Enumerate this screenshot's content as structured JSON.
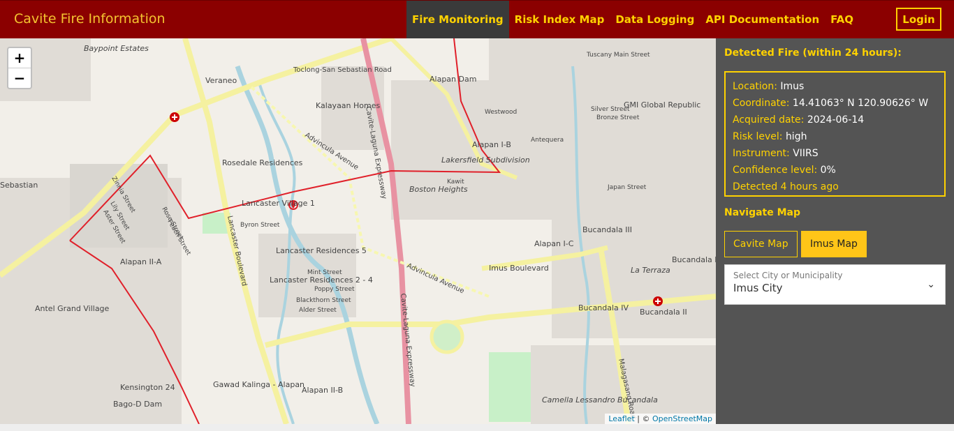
{
  "navbar": {
    "brand": "Cavite Fire Information",
    "links": [
      {
        "label": "Fire Monitoring"
      },
      {
        "label": "Risk Index Map"
      },
      {
        "label": "Data Logging"
      },
      {
        "label": "API Documentation"
      },
      {
        "label": "FAQ"
      }
    ],
    "login_label": "Login"
  },
  "map": {
    "zoom_in": "+",
    "zoom_out": "−",
    "labels": {
      "veraneo": "Veraneo",
      "kalayaan_homes": "Kalayaan Homes",
      "rosedale": "Rosedale Residences",
      "lancaster1": "Lancaster Village 1",
      "lancaster5": "Lancaster Residences 5",
      "lancaster24": "Lancaster Residences 2 - 4",
      "advincula": "Advincula Avenue",
      "cavite_laguna": "Cavite-Laguna Expressway",
      "lancaster_blvd": "Lancaster Boulevard",
      "alapan_dam": "Alapan Dam",
      "alapan_ib": "Alapan I-B",
      "alapan_ic": "Alapan I-C",
      "alapan_iia": "Alapan II-A",
      "alapan_iib": "Alapan II-B",
      "lakersfield": "Lakersfield Subdivision",
      "boston_heights": "Boston Heights",
      "imus_blvd": "Imus Boulevard",
      "bucandala3": "Bucandala III",
      "bucandala4": "Bucandala IV",
      "bucandala2": "Bucandala II",
      "bucandala1": "Bucandala I",
      "gmi": "GMI Global Republic",
      "antel": "Antel Grand Village",
      "kensington": "Kensington 24",
      "bago_dam": "Bago-D Dam",
      "gawad": "Gawad Kalinga - Alapan",
      "malagasang": "Malagasang Road",
      "sebastian": "Sebastian",
      "baypoint": "Baypoint Estates",
      "toclong": "Toclong-San Sebastian Road",
      "camella": "Camella Lessandro Bucandala",
      "la_terraza": "La Terraza",
      "tuscany": "Tuscany Main Street",
      "japan_street": "Japan Street",
      "silver": "Silver Street",
      "bronze": "Bronze Street",
      "mint": "Mint Street",
      "alder": "Alder Street",
      "poppy": "Poppy Street",
      "blackthorn": "Blackthorn Street",
      "byron": "Byron Street",
      "peach": "Peach Street",
      "rose": "Rose Street",
      "zinnia": "Zinnia Street",
      "lily": "Lily Street",
      "aster": "Aster Street",
      "westwood": "Westwood",
      "antequera": "Antequera",
      "kawit": "Kawit"
    },
    "attribution": {
      "leaflet": "Leaflet",
      "sep": "| ©",
      "osm": "OpenStreetMap"
    }
  },
  "panel": {
    "fire_heading": "Detected Fire (within 24 hours):",
    "fire": {
      "location_label": "Location:",
      "location": "Imus",
      "coordinate_label": "Coordinate:",
      "coordinate": "14.41063° N 120.90626° W",
      "acquired_label": "Acquired date:",
      "acquired": "2024-06-14",
      "risk_label": "Risk level:",
      "risk": "high",
      "instrument_label": "Instrument:",
      "instrument": "VIIRS",
      "confidence_label": "Confidence level:",
      "confidence": "0%",
      "detected": "Detected 4 hours ago"
    },
    "navigate_heading": "Navigate Map",
    "cavite_btn": "Cavite Map",
    "imus_btn": "Imus Map",
    "select_placeholder": "Select City or Municipality",
    "select_value": "Imus City"
  },
  "colors": {
    "navbar": "#8b0000",
    "accent": "#ffd200",
    "panel": "#545454",
    "boundary": "#e0202a"
  }
}
